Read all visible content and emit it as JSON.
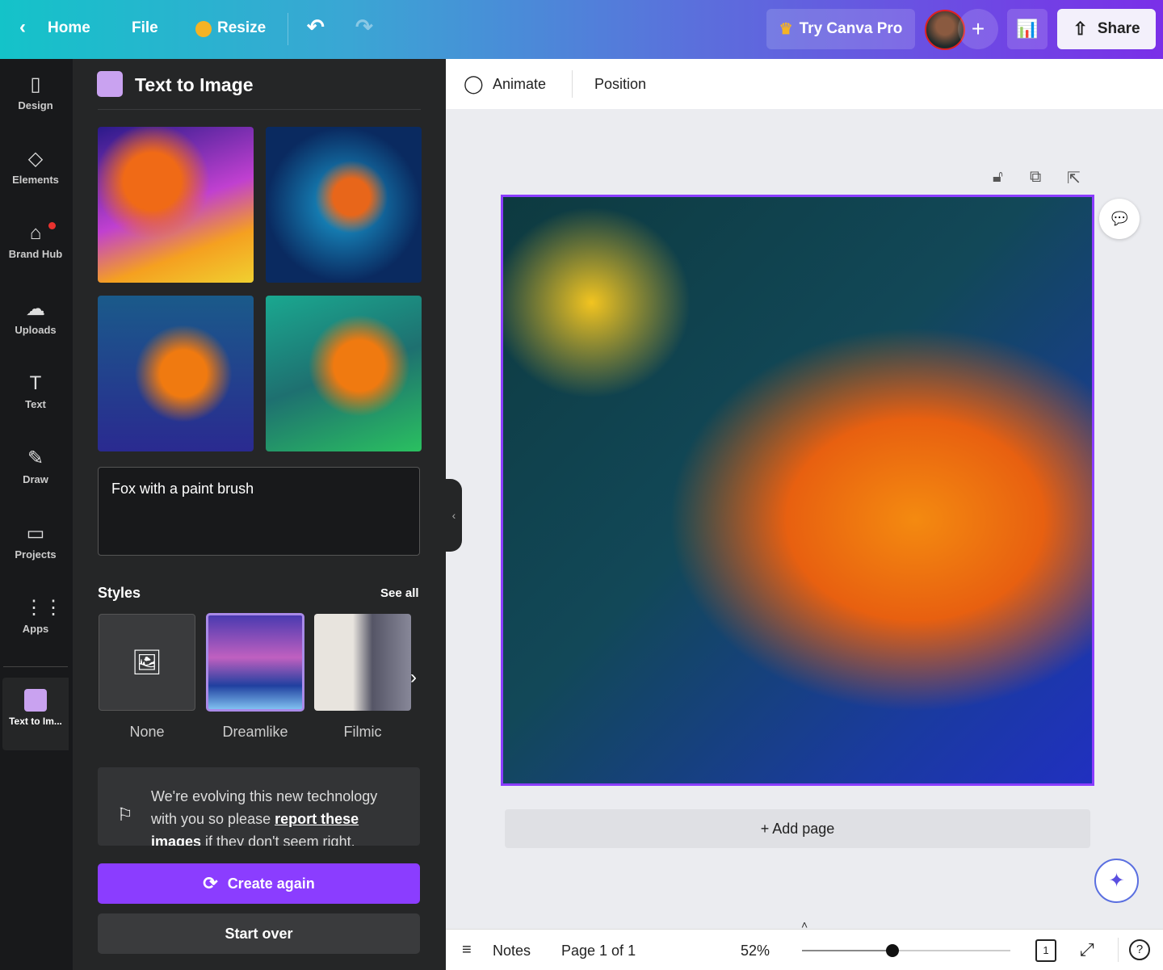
{
  "topbar": {
    "home": "Home",
    "file": "File",
    "resize": "Resize",
    "try_pro": "Try Canva Pro",
    "share": "Share"
  },
  "rail": [
    {
      "label": "Design",
      "icon": "▯"
    },
    {
      "label": "Elements",
      "icon": "◇"
    },
    {
      "label": "Brand Hub",
      "icon": "⌂"
    },
    {
      "label": "Uploads",
      "icon": "☁"
    },
    {
      "label": "Text",
      "icon": "T"
    },
    {
      "label": "Draw",
      "icon": "✎"
    },
    {
      "label": "Projects",
      "icon": "▭"
    },
    {
      "label": "Apps",
      "icon": "⋮⋮"
    },
    {
      "label": "Text to Im..."
    }
  ],
  "panel": {
    "title": "Text to Image",
    "prompt": "Fox with a paint brush",
    "styles_label": "Styles",
    "see_all": "See all",
    "styles": [
      {
        "label": "None"
      },
      {
        "label": "Dreamlike"
      },
      {
        "label": "Filmic"
      }
    ],
    "notice_pre": "We're evolving this new technology with you so please ",
    "notice_link": "report these images",
    "notice_post": " if they don't seem right.",
    "create_again": "Create again",
    "start_over": "Start over"
  },
  "toolbar": {
    "animate": "Animate",
    "position": "Position"
  },
  "canvas": {
    "add_page": "+ Add page",
    "accent": "#8b3dff"
  },
  "bottom": {
    "notes": "Notes",
    "page": "Page 1 of 1",
    "zoom": "52%",
    "zoom_value": 52,
    "page_count": "1"
  }
}
